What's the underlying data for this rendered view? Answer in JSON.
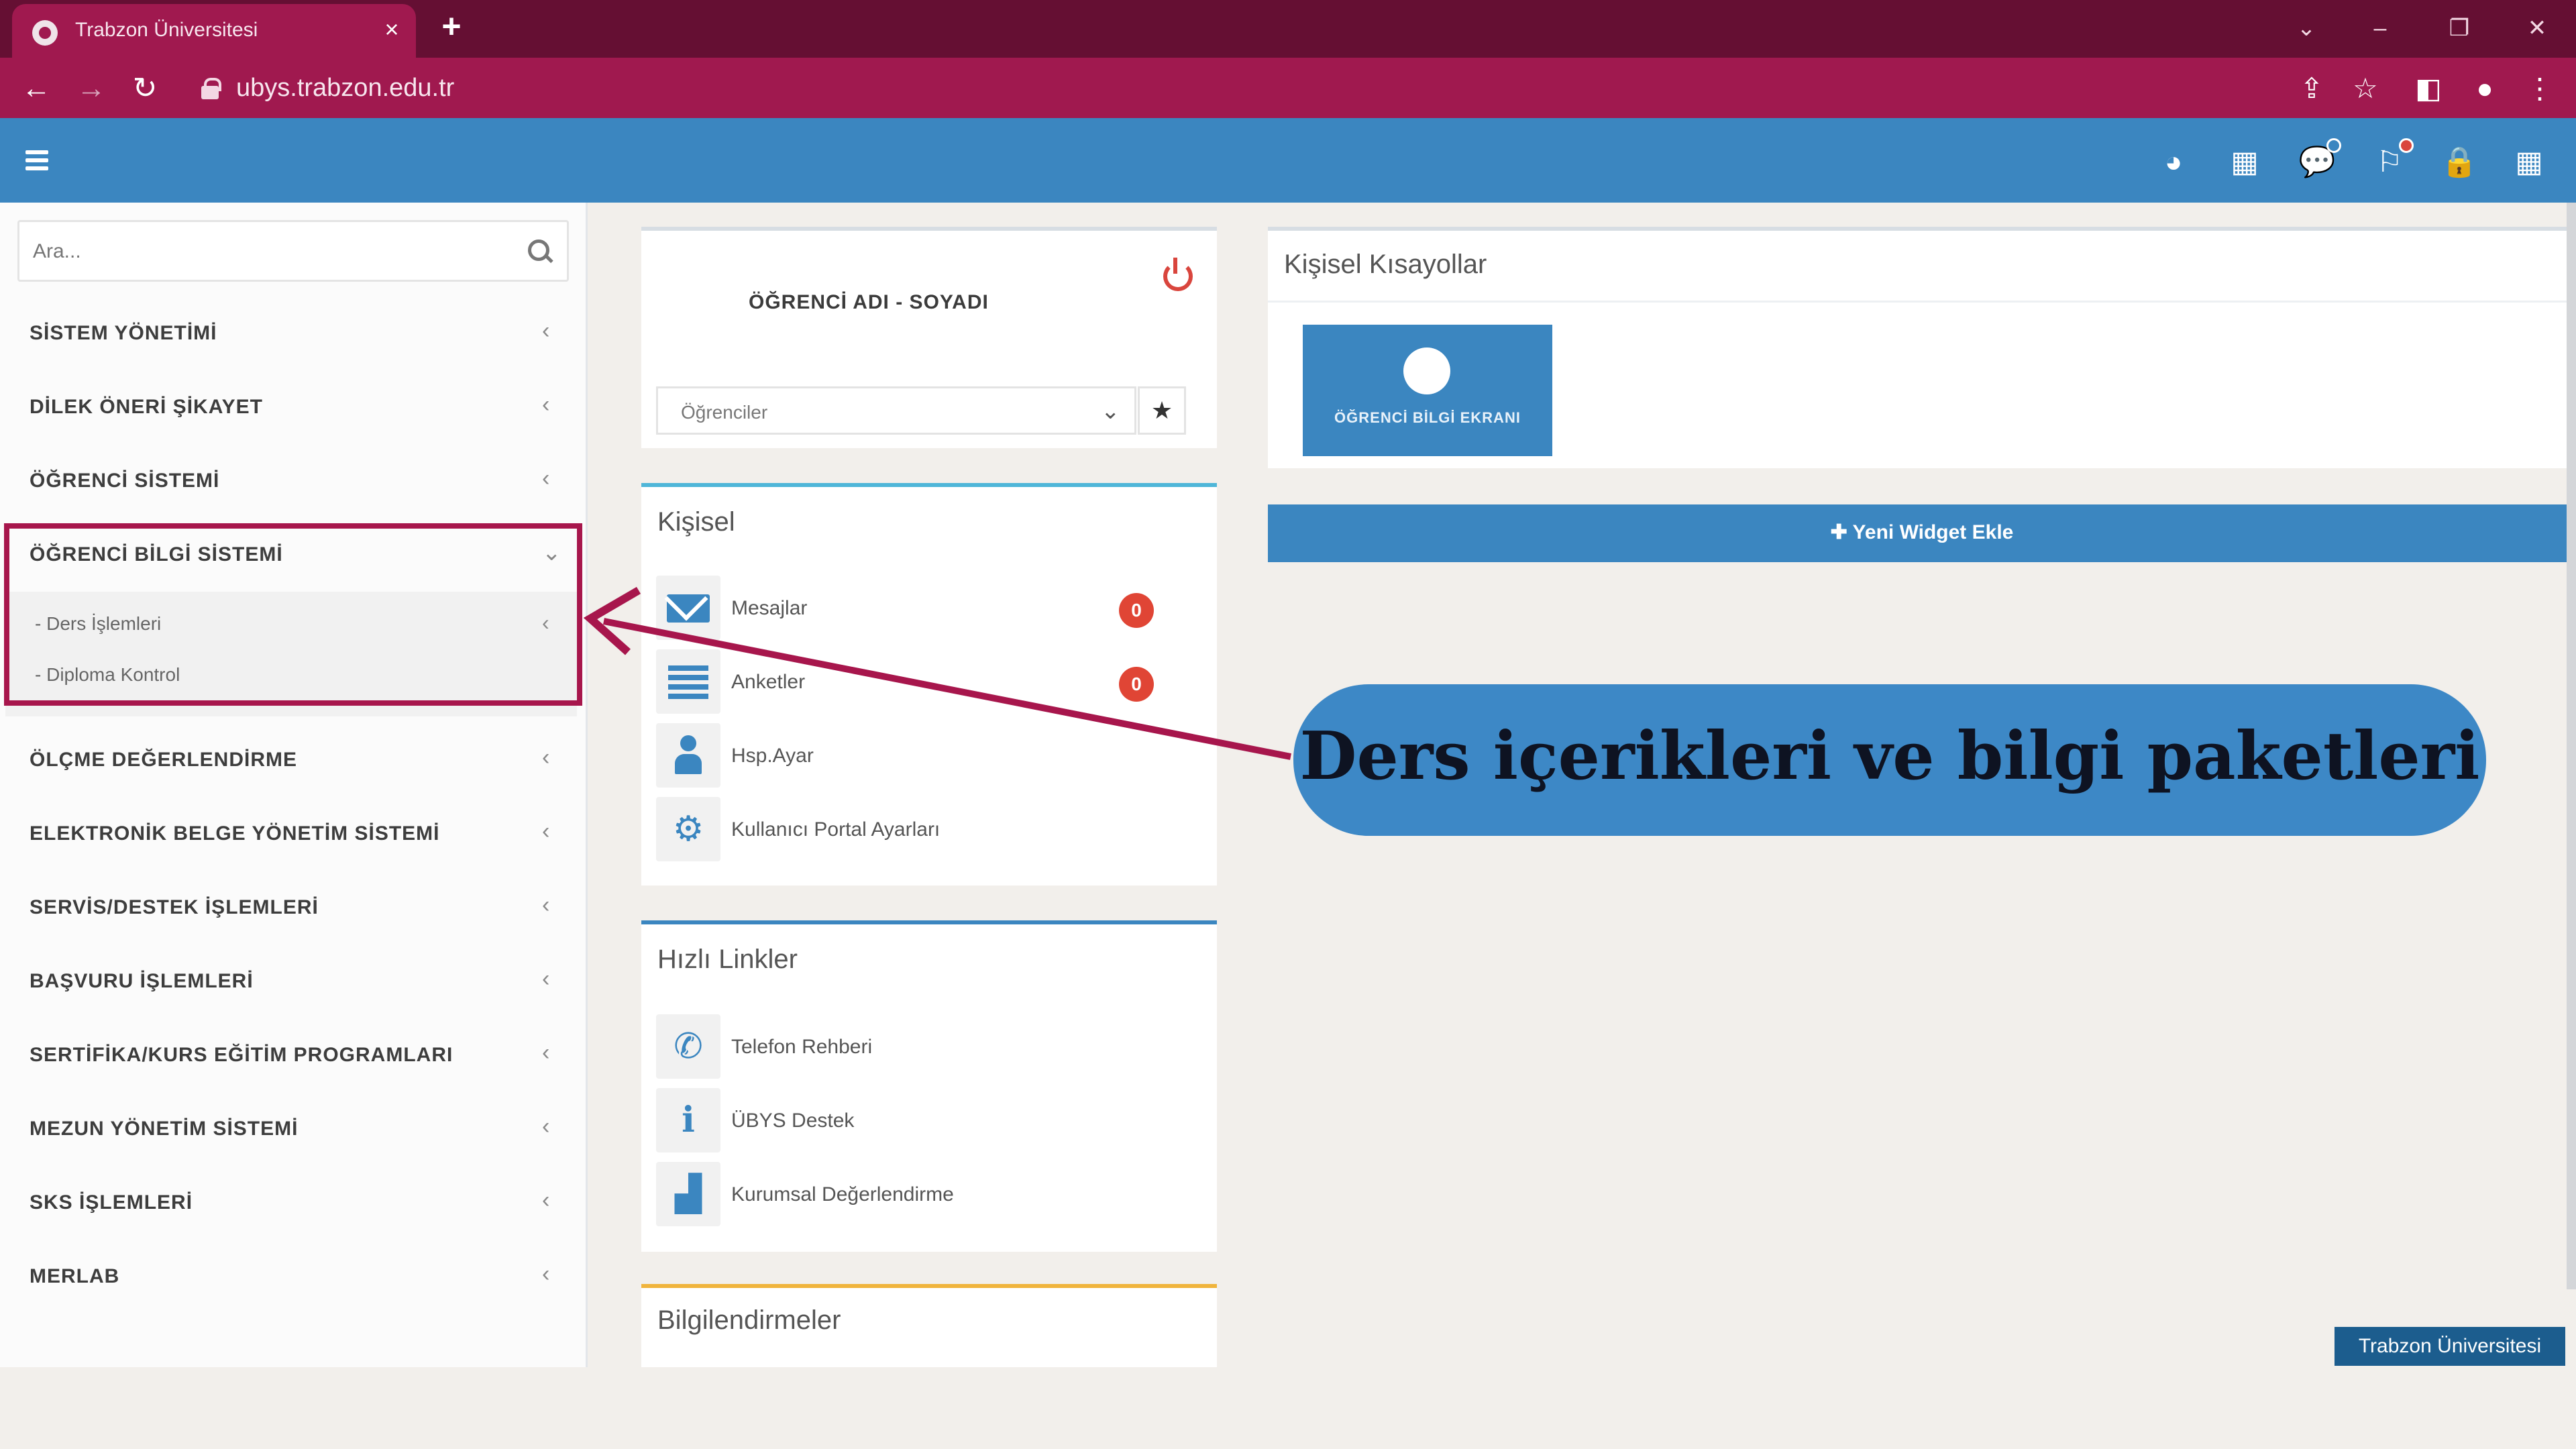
{
  "browser": {
    "tab_title": "Trabzon Üniversitesi",
    "tab_close": "×",
    "new_tab": "+",
    "url": "ubys.trabzon.edu.tr",
    "window_controls": [
      "⌄",
      "–",
      "❐",
      "✕"
    ],
    "nav": {
      "back": "←",
      "forward": "→",
      "reload": "↻"
    },
    "toolbar_icons": [
      "share-icon",
      "star-icon",
      "sidepanel-icon",
      "profile-icon",
      "menu-icon"
    ]
  },
  "header": {
    "icons": [
      "dashboard-icon",
      "calendar-icon",
      "chat-icon",
      "flag-icon",
      "lock-icon",
      "apps-grid-icon"
    ]
  },
  "sidebar": {
    "search_placeholder": "Ara...",
    "items": [
      {
        "label": "SİSTEM YÖNETİMİ",
        "chevron": "‹"
      },
      {
        "label": "DİLEK ÖNERİ ŞİKAYET",
        "chevron": "‹"
      },
      {
        "label": "ÖĞRENCİ SİSTEMİ",
        "chevron": "‹"
      },
      {
        "label": "ÖĞRENCİ BİLGİ SİSTEMİ",
        "chevron": "⌄"
      },
      {
        "label": "ÖLÇME DEĞERLENDİRME",
        "chevron": "‹"
      },
      {
        "label": "ELEKTRONİK BELGE YÖNETİM SİSTEMİ",
        "chevron": "‹"
      },
      {
        "label": "SERVİS/DESTEK İŞLEMLERİ",
        "chevron": "‹"
      },
      {
        "label": "BAŞVURU İŞLEMLERİ",
        "chevron": "‹"
      },
      {
        "label": "SERTİFİKA/KURS EĞİTİM PROGRAMLARI",
        "chevron": "‹"
      },
      {
        "label": "MEZUN YÖNETİM SİSTEMİ",
        "chevron": "‹"
      },
      {
        "label": "SKS İŞLEMLERİ",
        "chevron": "‹"
      },
      {
        "label": "MERLAB",
        "chevron": "‹"
      }
    ],
    "submenu": [
      {
        "label": "- Ders İşlemleri",
        "chevron": "‹"
      },
      {
        "label": "- Diploma Kontrol",
        "chevron": ""
      }
    ]
  },
  "profile": {
    "student_name": "ÖĞRENCİ ADI - SOYADI",
    "role_selected": "Öğrenciler",
    "star": "★"
  },
  "personal": {
    "title": "Kişisel",
    "rows": [
      {
        "label": "Mesajlar",
        "badge": "0"
      },
      {
        "label": "Anketler",
        "badge": "0"
      },
      {
        "label": "Hsp.Ayar",
        "badge": ""
      },
      {
        "label": "Kullanıcı Portal Ayarları",
        "badge": ""
      }
    ]
  },
  "quick_links": {
    "title": "Hızlı Linkler",
    "rows": [
      {
        "label": "Telefon Rehberi"
      },
      {
        "label": "ÜBYS Destek"
      },
      {
        "label": "Kurumsal Değerlendirme"
      }
    ]
  },
  "info": {
    "title": "Bilgilendirmeler"
  },
  "shortcuts": {
    "title": "Kişisel Kısayollar",
    "tile_label": "ÖĞRENCİ BİLGİ EKRANI"
  },
  "widget_bar": {
    "label": "✚ Yeni Widget Ekle"
  },
  "callout": {
    "text": "Ders içerikleri ve bilgi paketleri"
  },
  "footer": {
    "badge": "Trabzon Üniversitesi"
  },
  "colors": {
    "browser_dark": "#650f33",
    "browser_accent": "#a0194f",
    "primary_blue": "#3b86c0",
    "annotation": "#a7164c",
    "badge_red": "#e04535"
  }
}
